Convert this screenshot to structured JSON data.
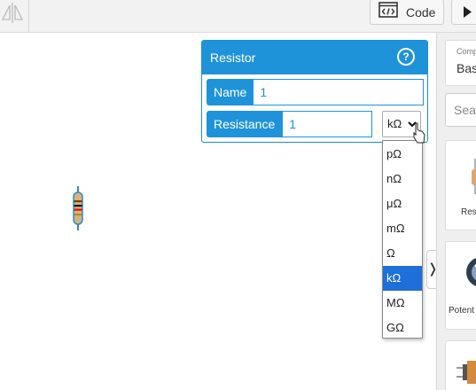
{
  "toolbar": {
    "code_label": "Code",
    "code_icon": "code-editor-icon",
    "run_icon": "play-icon"
  },
  "inspector": {
    "title": "Resistor",
    "help_glyph": "?",
    "name_label": "Name",
    "name_value": "1",
    "resistance_label": "Resistance",
    "resistance_value": "1",
    "unit_selected": "kΩ"
  },
  "unit_options": [
    {
      "label": "pΩ",
      "selected": false
    },
    {
      "label": "nΩ",
      "selected": false
    },
    {
      "label": "μΩ",
      "selected": false
    },
    {
      "label": "mΩ",
      "selected": false
    },
    {
      "label": "Ω",
      "selected": false
    },
    {
      "label": "kΩ",
      "selected": true
    },
    {
      "label": "MΩ",
      "selected": false
    },
    {
      "label": "GΩ",
      "selected": false
    }
  ],
  "sidebar": {
    "components_label": "Comp",
    "components_value": "Bas",
    "search_placeholder": "Sea",
    "items": [
      {
        "label": "Res"
      },
      {
        "label": "Potent"
      }
    ],
    "collapse_glyph": "❭"
  },
  "colors": {
    "accent": "#1f93d9",
    "selected_option": "#1e6fd9"
  }
}
